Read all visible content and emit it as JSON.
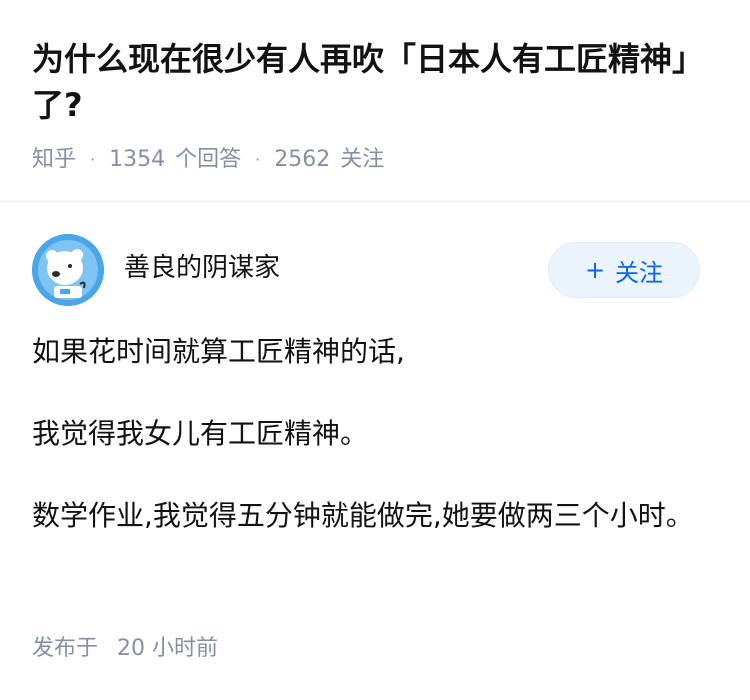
{
  "question": {
    "title": "为什么现在很少有人再吹「日本人有工匠精神」了?",
    "site": "知乎",
    "answer_count": "1354",
    "answer_label": "个回答",
    "follower_count": "2562",
    "follower_label": "关注",
    "separator": "·"
  },
  "answer": {
    "author_name": "善良的阴谋家",
    "avatar_icon": "astronaut-bear-avatar",
    "follow_plus": "+",
    "follow_label": "关注",
    "paragraphs": [
      "如果花时间就算工匠精神的话,",
      "我觉得我女儿有工匠精神。",
      "数学作业,我觉得五分钟就能做完,她要做两三个小时。"
    ],
    "published_label": "发布于",
    "published_time": "20 小时前"
  },
  "colors": {
    "meta_gray": "#8590a6",
    "follow_bg": "#ebf3fc",
    "follow_text": "#0a66e8",
    "avatar_bg": "#49a6e8"
  }
}
